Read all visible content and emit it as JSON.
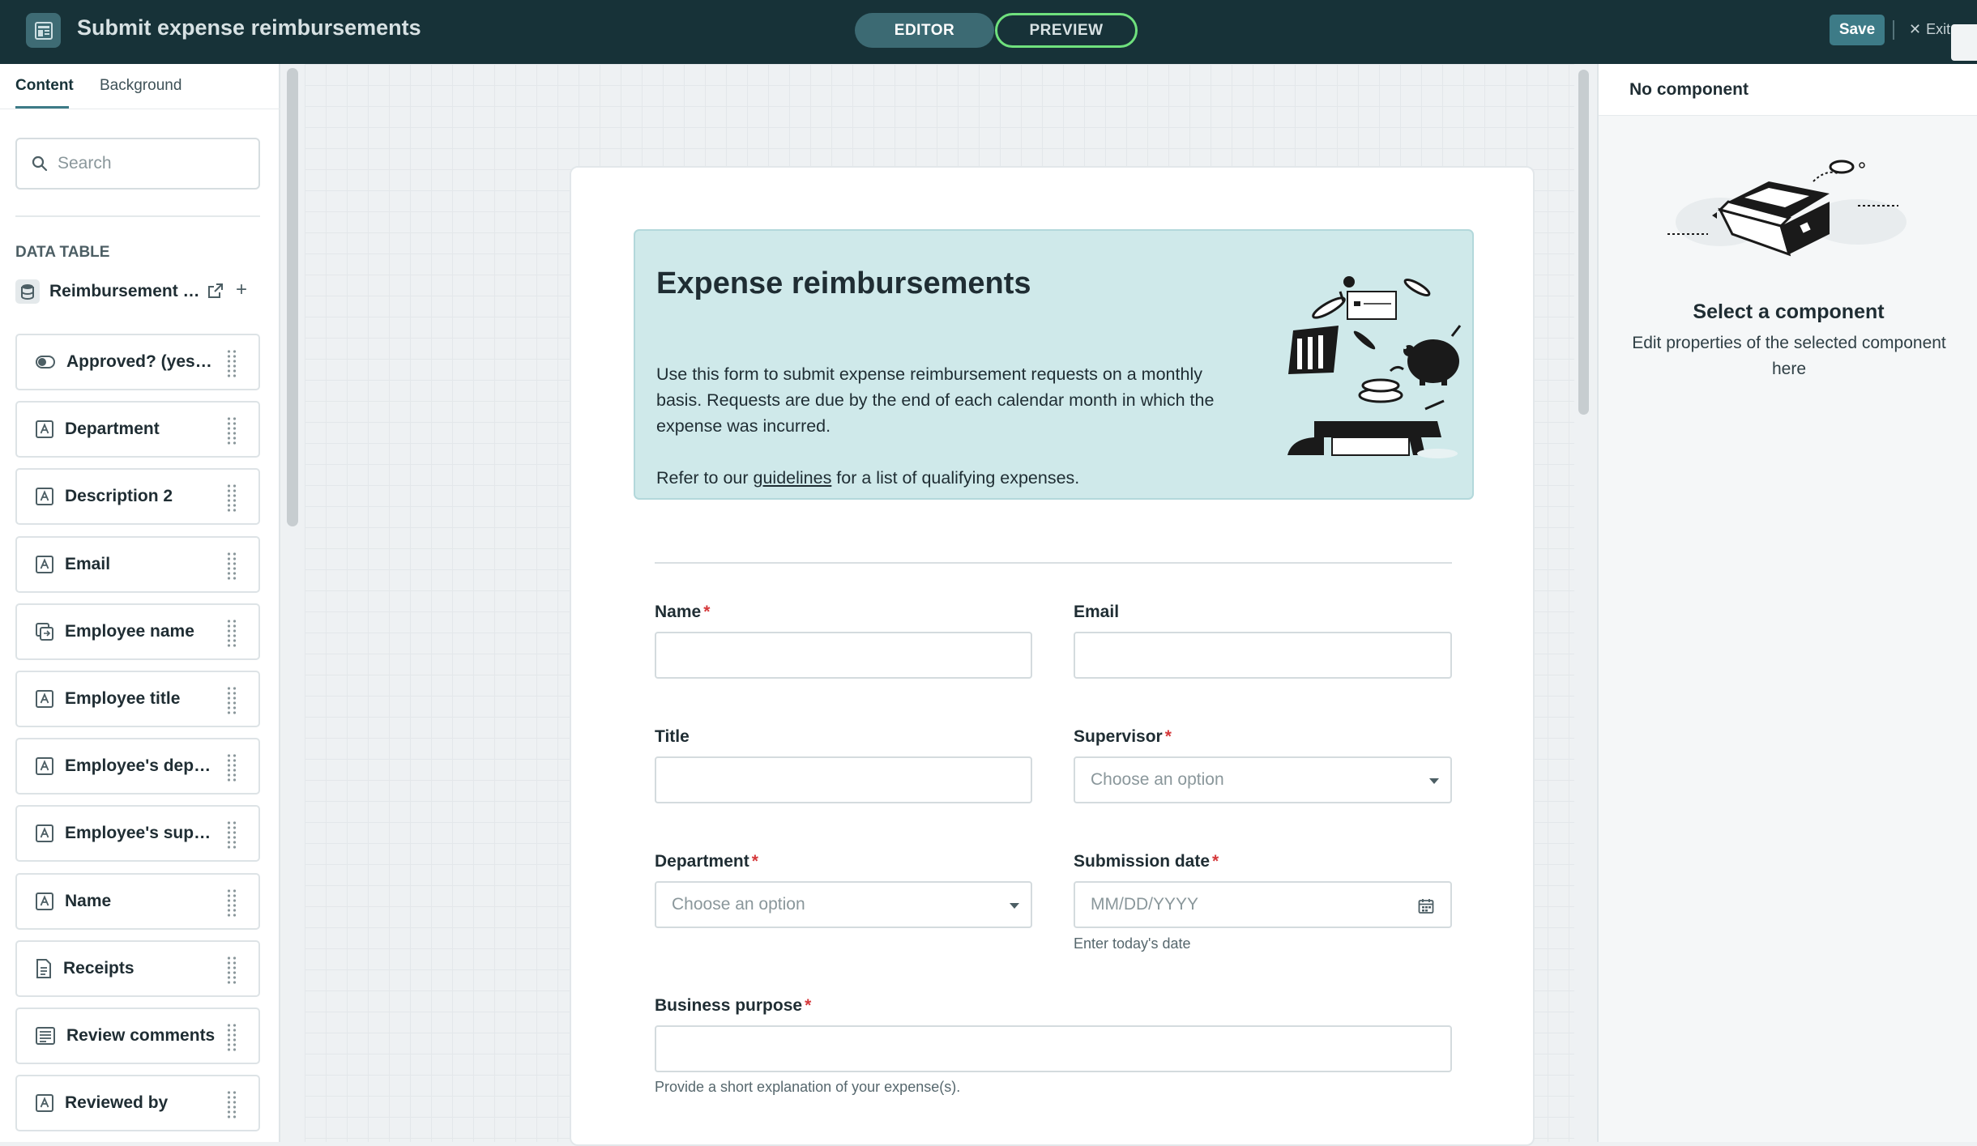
{
  "topbar": {
    "title": "Submit expense reimbursements",
    "mode_editor": "EDITOR",
    "mode_preview": "PREVIEW",
    "save_label": "Save",
    "exit_label": "Exit"
  },
  "sidebar": {
    "tabs": [
      "Content",
      "Background"
    ],
    "search_placeholder": "Search",
    "data_table_heading": "DATA TABLE",
    "table_name": "Reimbursement …",
    "fields": [
      {
        "label": "Approved? (yes/…",
        "icon": "toggle-icon"
      },
      {
        "label": "Department",
        "icon": "text-field-icon"
      },
      {
        "label": "Description 2",
        "icon": "text-field-icon"
      },
      {
        "label": "Email",
        "icon": "text-field-icon"
      },
      {
        "label": "Employee name",
        "icon": "lookup-field-icon"
      },
      {
        "label": "Employee title",
        "icon": "text-field-icon"
      },
      {
        "label": "Employee's depa…",
        "icon": "text-field-icon"
      },
      {
        "label": "Employee's supe…",
        "icon": "text-field-icon"
      },
      {
        "label": "Name",
        "icon": "text-field-icon"
      },
      {
        "label": "Receipts",
        "icon": "file-icon"
      },
      {
        "label": "Review comments",
        "icon": "paragraph-field-icon"
      },
      {
        "label": "Reviewed by",
        "icon": "text-field-icon"
      }
    ]
  },
  "form": {
    "banner_title": "Expense reimbursements",
    "banner_description": "Use this form to submit expense reimbursement requests on a monthly basis. Requests are due by the end of each calendar month in which the expense was incurred.",
    "banner_refer_prefix": "Refer to our ",
    "banner_refer_link": "guidelines",
    "banner_refer_suffix": " for a list of qualifying expenses.",
    "name_label": "Name",
    "email_label": "Email",
    "title_label": "Title",
    "supervisor_label": "Supervisor",
    "supervisor_placeholder": "Choose an option",
    "department_label": "Department",
    "department_placeholder": "Choose an option",
    "submission_date_label": "Submission date",
    "submission_date_placeholder": "MM/DD/YYYY",
    "submission_date_help": "Enter today's date",
    "business_purpose_label": "Business purpose",
    "business_purpose_help": "Provide a short explanation of your expense(s).",
    "required_mark": "*"
  },
  "right_panel": {
    "title": "No component",
    "heading": "Select a component",
    "subtext": "Edit properties of the selected component here"
  },
  "colors": {
    "topbar_bg": "#173238",
    "accent": "#3d7b87",
    "preview_outline": "#6fe07d",
    "banner_bg": "#cfe9ea",
    "required": "#d5393b"
  }
}
